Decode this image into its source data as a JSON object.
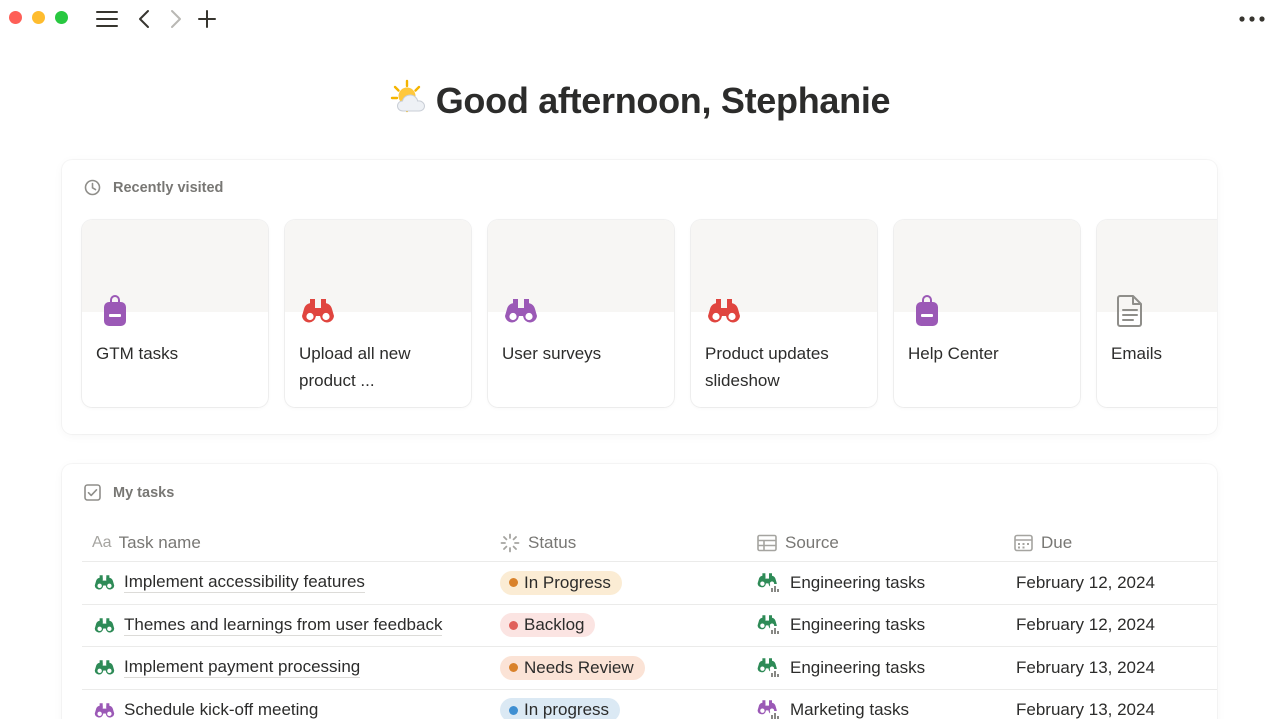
{
  "window": {
    "traffic_lights": [
      "#fe5f57",
      "#febc2e",
      "#28c840"
    ],
    "toolbar": {
      "menu_icon": "hamburger-menu-icon",
      "back_icon": "chevron-left-icon",
      "forward_icon": "chevron-right-icon",
      "add_icon": "plus-icon",
      "more_icon": "more-horizontal-icon"
    }
  },
  "greeting": {
    "emoji": "sun-behind-cloud",
    "text": "Good afternoon, Stephanie"
  },
  "recently_visited": {
    "title": "Recently visited",
    "items": [
      {
        "title": "GTM tasks",
        "icon": "backpack-icon",
        "color": "#9b59b6"
      },
      {
        "title": "Upload all new product ...",
        "icon": "binoculars-icon",
        "color": "#e0453f"
      },
      {
        "title": "User surveys",
        "icon": "binoculars-icon",
        "color": "#9b59b6"
      },
      {
        "title": "Product updates slideshow",
        "icon": "binoculars-icon",
        "color": "#e0453f"
      },
      {
        "title": "Help Center",
        "icon": "backpack-icon",
        "color": "#9b59b6"
      },
      {
        "title": "Emails",
        "icon": "document-icon",
        "color": "#8f8e8a"
      }
    ]
  },
  "my_tasks": {
    "title": "My tasks",
    "columns": [
      "Task name",
      "Status",
      "Source",
      "Due"
    ],
    "rows": [
      {
        "name": "Implement accessibility features",
        "icon_color": "#2e8b57",
        "status": "In Progress",
        "status_bg": "#fbecd4",
        "status_dot": "#d9822b",
        "source": "Engineering tasks",
        "source_color": "#2e8b57",
        "due": "February 12, 2024"
      },
      {
        "name": "Themes and learnings from user feedback",
        "icon_color": "#2e8b57",
        "status": "Backlog",
        "status_bg": "#fbe4e2",
        "status_dot": "#e0605a",
        "source": "Engineering tasks",
        "source_color": "#2e8b57",
        "due": "February 12, 2024"
      },
      {
        "name": "Implement payment processing",
        "icon_color": "#2e8b57",
        "status": "Needs Review",
        "status_bg": "#fbe3d6",
        "status_dot": "#d9822b",
        "source": "Engineering tasks",
        "source_color": "#2e8b57",
        "due": "February 13, 2024"
      },
      {
        "name": "Schedule kick-off meeting",
        "icon_color": "#9b59b6",
        "status": "In progress",
        "status_bg": "#dbe9f4",
        "status_dot": "#3f8fd2",
        "source": "Marketing tasks",
        "source_color": "#9b59b6",
        "due": "February 13, 2024"
      }
    ]
  }
}
